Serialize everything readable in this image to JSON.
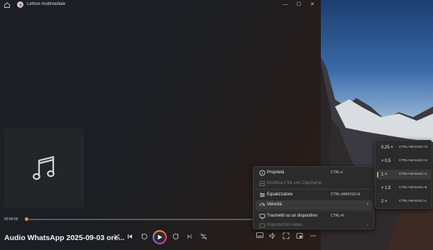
{
  "window": {
    "title": "Lettore multimediale",
    "minimize": "—",
    "maximize": "☐",
    "close": "✕"
  },
  "player": {
    "current_time": "00:00:00",
    "track_title": "Audio WhatsApp 2025-09-03 ore...",
    "progress": 0
  },
  "context_menu": {
    "items": [
      {
        "label": "Proprietà",
        "shortcut": "CTRL+I",
        "icon": "info-icon",
        "enabled": true
      },
      {
        "label": "Modifica il file con Clipchamp",
        "shortcut": "",
        "icon": "clipchamp-icon",
        "enabled": false
      },
      {
        "label": "Equalizzatore",
        "shortcut": "CTRL+MAIUSC+E",
        "icon": "equalizer-icon",
        "enabled": true
      },
      {
        "label": "Velocità",
        "shortcut": "",
        "icon": "speed-icon",
        "enabled": true,
        "submenu": true
      },
      {
        "label": "Trasmetti su un dispositivo",
        "shortcut": "CTRL+K",
        "icon": "cast-icon",
        "enabled": true
      },
      {
        "label": "Impostazioni video",
        "shortcut": "",
        "icon": "video-settings-icon",
        "enabled": false,
        "submenu": true
      }
    ]
  },
  "speed_menu": {
    "items": [
      {
        "label": "0,25 ×",
        "shortcut": "CTRL+MAIUSC+G",
        "selected": false
      },
      {
        "label": "× 0,5",
        "shortcut": "CTRL+MAIUSC+H",
        "selected": false
      },
      {
        "label": "1 ×",
        "shortcut": "CTRL+MAIUSC+J",
        "selected": true
      },
      {
        "label": "× 1,5",
        "shortcut": "CTRL+MAIUSC+K",
        "selected": false
      },
      {
        "label": "2 ×",
        "shortcut": "CTRL+MAIUSC+L",
        "selected": false
      }
    ]
  },
  "colors": {
    "accent": "#f08a3c",
    "menu_bg": "#2b2b2b",
    "window_bg": "#1c2026"
  }
}
